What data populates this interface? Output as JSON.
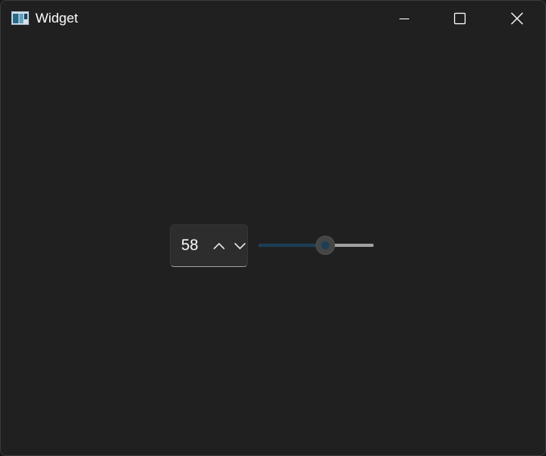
{
  "window": {
    "title": "Widget"
  },
  "spinbox": {
    "value": "58"
  },
  "slider": {
    "value": 58,
    "min": 0,
    "max": 100
  },
  "colors": {
    "accent": "#1c3e56",
    "background": "#202020",
    "text": "#ffffff"
  },
  "icons": {
    "app": "app-icon",
    "minimize": "minimize-icon",
    "maximize": "maximize-icon",
    "close": "close-icon",
    "spin_up": "chevron-up-icon",
    "spin_down": "chevron-down-icon"
  }
}
